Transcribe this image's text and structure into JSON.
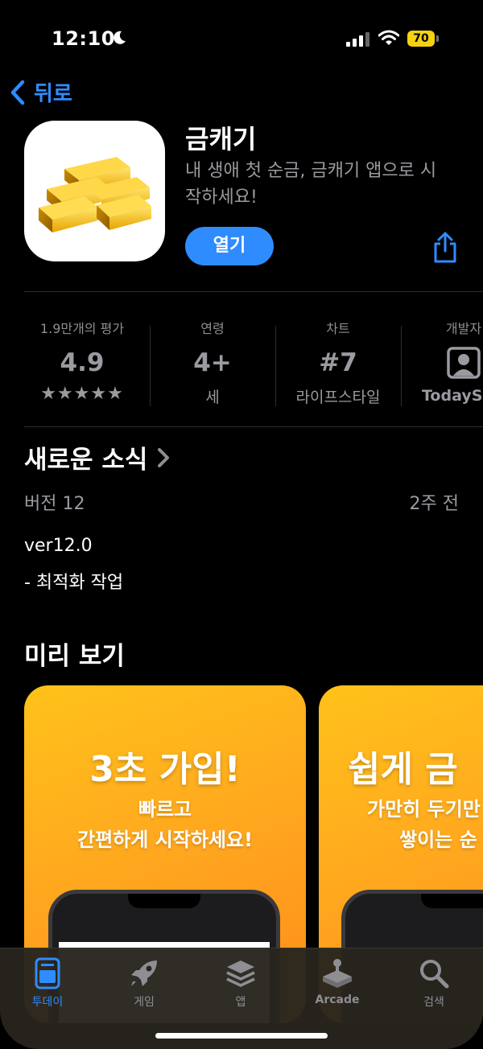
{
  "status_bar": {
    "time": "12:10",
    "battery": "70"
  },
  "nav": {
    "back_label": "뒤로"
  },
  "app": {
    "title": "금캐기",
    "subtitle": "내 생애 첫 순금, 금캐기 앱으로 시작하세요!",
    "open_label": "열기"
  },
  "stats": [
    {
      "label": "1.9만개의 평가",
      "value": "4.9",
      "sub": "★★★★★"
    },
    {
      "label": "연령",
      "value": "4+",
      "sub": "세"
    },
    {
      "label": "차트",
      "value": "#7",
      "sub": "라이프스타일"
    },
    {
      "label": "개발자",
      "value": "",
      "sub": "TodaySp"
    }
  ],
  "whats_new": {
    "title": "새로운 소식",
    "version": "버전 12",
    "ago": "2주 전",
    "notes_line1": "ver12.0",
    "notes_line2": "- 최적화 작업"
  },
  "preview": {
    "title": "미리 보기",
    "cards": [
      {
        "big": "3초 가입!",
        "line1": "빠르고",
        "line2": "간편하게 시작하세요!"
      },
      {
        "big": "쉽게 금",
        "line1": "가만히 두기만",
        "line2": "쌓이는 순"
      }
    ]
  },
  "tabbar": {
    "items": [
      {
        "label": "투데이",
        "icon": "today-icon",
        "active": true
      },
      {
        "label": "게임",
        "icon": "rocket-icon",
        "active": false
      },
      {
        "label": "앱",
        "icon": "layers-icon",
        "active": false
      },
      {
        "label": "Arcade",
        "icon": "joystick-icon",
        "active": false
      },
      {
        "label": "검색",
        "icon": "search-icon",
        "active": false
      }
    ]
  },
  "colors": {
    "accent": "#2f8cff",
    "battery": "#f5d20d",
    "card": "#ffa41f"
  }
}
